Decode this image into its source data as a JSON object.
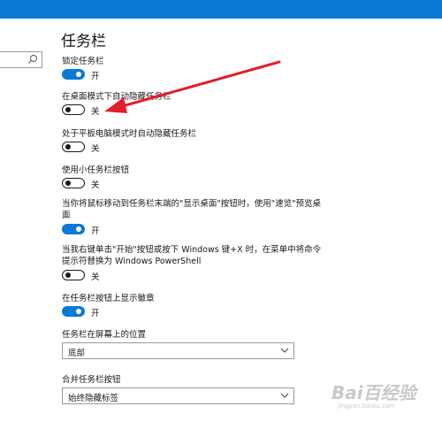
{
  "page_title": "任务栏",
  "settings": [
    {
      "label": "锁定任务栏",
      "state": "开",
      "on": true
    },
    {
      "label": "在桌面模式下自动隐藏任务栏",
      "state": "关",
      "on": false
    },
    {
      "label": "处于平板电脑模式时自动隐藏任务栏",
      "state": "关",
      "on": false
    },
    {
      "label": "使用小任务栏按钮",
      "state": "关",
      "on": false
    },
    {
      "label": "当你将鼠标移动到任务栏末端的\"显示桌面\"按钮时，使用\"速览\"预览桌面",
      "state": "开",
      "on": true
    },
    {
      "label": "当我右键单击\"开始\"按钮或按下 Windows 键+X 时，在菜单中将命令提示符替换为 Windows PowerShell",
      "state": "关",
      "on": false
    },
    {
      "label": "在任务栏按钮上显示徽章",
      "state": "开",
      "on": true
    }
  ],
  "position_select": {
    "label": "任务栏在屏幕上的位置",
    "value": "底部"
  },
  "combine_select": {
    "label": "合并任务栏按钮",
    "value": "始终隐藏标签"
  },
  "watermark": {
    "main": "Bai百经验",
    "sub": "jingyan.baidu.com"
  },
  "colors": {
    "accent": "#0a78d7",
    "arrow": "#e0202a"
  }
}
